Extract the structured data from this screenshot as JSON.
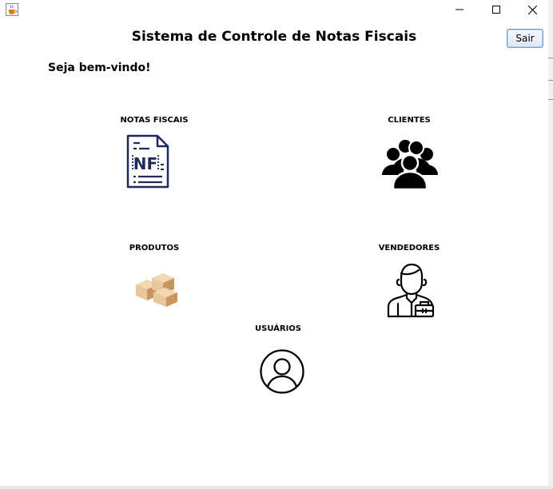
{
  "window": {
    "icon": "java-cup-icon",
    "controls": [
      "minimize-icon",
      "maximize-icon",
      "close-icon"
    ]
  },
  "header": {
    "title": "Sistema de Controle de Notas Fiscais",
    "logout_label": "Sair"
  },
  "welcome": "Seja bem-vindo!",
  "modules": {
    "notas": {
      "label": "NOTAS FISCAIS",
      "icon": "invoice-nf-icon"
    },
    "clientes": {
      "label": "CLIENTES",
      "icon": "people-group-icon"
    },
    "produtos": {
      "label": "PRODUTOS",
      "icon": "boxes-icon"
    },
    "vendedores": {
      "label": "VENDEDORES",
      "icon": "salesman-icon"
    },
    "usuarios": {
      "label": "USUÁRIOS",
      "icon": "user-circle-icon"
    }
  },
  "colors": {
    "nf_icon": "#1f2a5c",
    "box_light": "#e9c79c",
    "box_dark": "#c9955f",
    "button_border": "#7a9cc9"
  }
}
